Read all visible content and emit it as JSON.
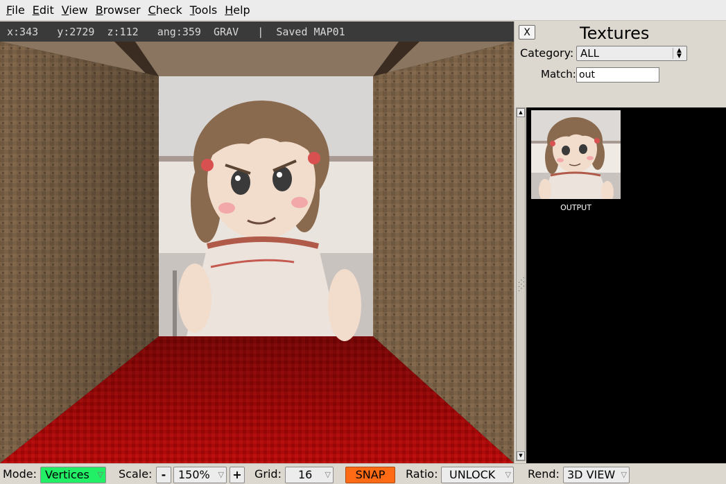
{
  "menu": [
    {
      "label_ul": "F",
      "label_rest": "ile"
    },
    {
      "label_ul": "E",
      "label_rest": "dit"
    },
    {
      "label_ul": "V",
      "label_rest": "iew"
    },
    {
      "label_ul": "B",
      "label_rest": "rowser"
    },
    {
      "label_ul": "C",
      "label_rest": "heck"
    },
    {
      "label_ul": "T",
      "label_rest": "ools"
    },
    {
      "label_ul": "H",
      "label_rest": "elp"
    }
  ],
  "status": "x:343   y:2729  z:112   ang:359  GRAV   |  Saved MAP01",
  "texture_browser": {
    "close_label": "X",
    "title": "Textures",
    "category_label": "Category:",
    "category_value": "ALL",
    "match_label": "Match:",
    "match_value": "out",
    "items": [
      {
        "name": "OUTPUT"
      }
    ]
  },
  "toolbar": {
    "mode_label": "Mode:",
    "mode_value": "Vertices",
    "scale_label": "Scale:",
    "scale_minus": "-",
    "scale_value": "150%",
    "scale_plus": "+",
    "grid_label": "Grid:",
    "grid_value": "16",
    "snap_label": "SNAP",
    "ratio_label": "Ratio:",
    "ratio_value": "UNLOCK",
    "rend_label": "Rend:",
    "rend_value": "3D VIEW"
  },
  "colors": {
    "wall": "#7a6248",
    "floor": "#b30a0a",
    "ceiling": "#8a7560",
    "mode_active": "#22ee66",
    "snap_active": "#ff6a14"
  },
  "icons": {
    "close": "close-icon",
    "dropdown": "chevron-down-icon",
    "scroll_up": "arrow-up-icon",
    "scroll_down": "arrow-down-icon"
  }
}
